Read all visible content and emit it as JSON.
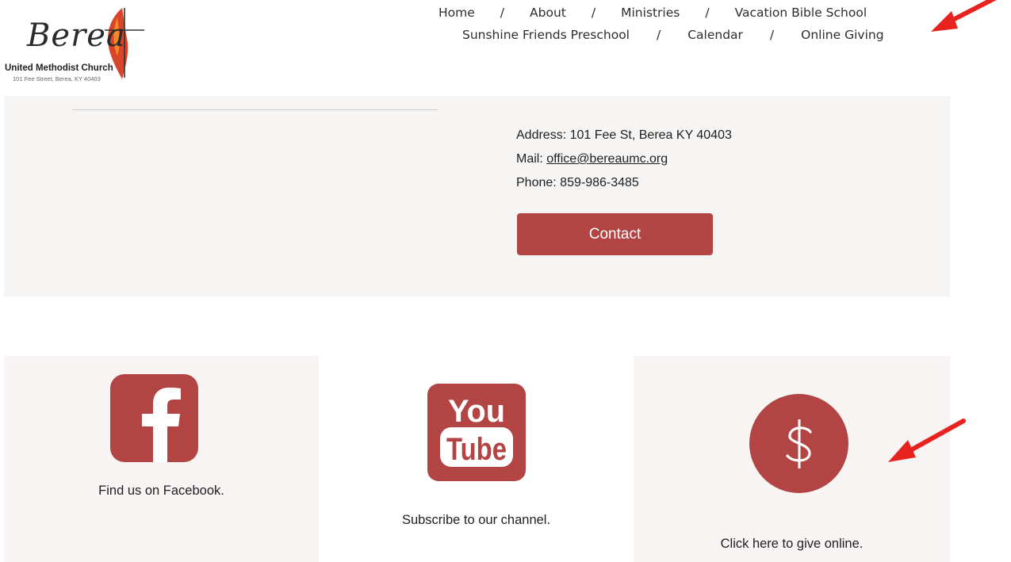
{
  "logo": {
    "script_text": "Berea",
    "church_name": "United Methodist Church",
    "address_line": "101 Fee Street, Berea, KY 40403"
  },
  "nav": {
    "row1": [
      "Home",
      "About",
      "Ministries",
      "Vacation Bible School"
    ],
    "row2": [
      "Sunshine Friends Preschool",
      "Calendar",
      "Online Giving"
    ],
    "separator": "/"
  },
  "contact": {
    "address_label": "Address:",
    "address_value": "101  Fee St, Berea KY 40403",
    "mail_label": "Mail:",
    "mail_value": "office@bereaumc.org",
    "phone_label": "Phone:",
    "phone_value": "859-986-3485",
    "button_label": "Contact"
  },
  "cards": {
    "facebook_text": "Find us on Facebook.",
    "youtube_text": "Subscribe to our channel.",
    "give_text": "Click here to give online."
  },
  "icons": {
    "facebook": "facebook-icon",
    "youtube": "youtube-icon",
    "give": "dollar-icon"
  },
  "colors": {
    "accent": "#b24444",
    "band": "#f7f5f4",
    "annotation_arrow": "#e8231f"
  }
}
